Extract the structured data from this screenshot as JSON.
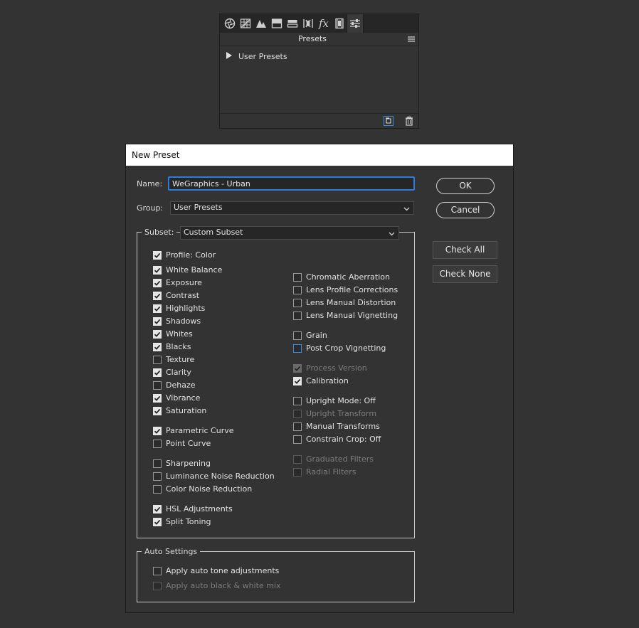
{
  "panel": {
    "title": "Presets",
    "tabs": [
      "basic-aperture-icon",
      "tone-curve-grid-icon",
      "hsl-mountains-icon",
      "split-toning-icon",
      "detail-icon",
      "lens-icon",
      "fx-icon",
      "film-camera-icon",
      "presets-sliders-icon"
    ],
    "fx_label": "fx",
    "tree_item": "User Presets"
  },
  "dialog": {
    "title": "New Preset",
    "name_label": "Name:",
    "name_value": "WeGraphics - Urban",
    "group_label": "Group:",
    "group_value": "User Presets",
    "subset_label": "Subset:",
    "subset_value": "Custom Subset",
    "ok_label": "OK",
    "cancel_label": "Cancel",
    "check_all_label": "Check All",
    "check_none_label": "Check None",
    "auto_settings_label": "Auto Settings",
    "left_items": [
      {
        "label": "Profile: Color",
        "checked": true,
        "disabled": false
      },
      {
        "label": "White Balance",
        "checked": true,
        "disabled": false
      },
      {
        "label": "Exposure",
        "checked": true,
        "disabled": false
      },
      {
        "label": "Contrast",
        "checked": true,
        "disabled": false
      },
      {
        "label": "Highlights",
        "checked": true,
        "disabled": false
      },
      {
        "label": "Shadows",
        "checked": true,
        "disabled": false
      },
      {
        "label": "Whites",
        "checked": true,
        "disabled": false
      },
      {
        "label": "Blacks",
        "checked": true,
        "disabled": false
      },
      {
        "label": "Texture",
        "checked": false,
        "disabled": false
      },
      {
        "label": "Clarity",
        "checked": true,
        "disabled": false
      },
      {
        "label": "Dehaze",
        "checked": false,
        "disabled": false
      },
      {
        "label": "Vibrance",
        "checked": true,
        "disabled": false
      },
      {
        "label": "Saturation",
        "checked": true,
        "disabled": false
      },
      {
        "label": "Parametric Curve",
        "checked": true,
        "disabled": false
      },
      {
        "label": "Point Curve",
        "checked": false,
        "disabled": false
      },
      {
        "label": "Sharpening",
        "checked": false,
        "disabled": false
      },
      {
        "label": "Luminance Noise Reduction",
        "checked": false,
        "disabled": false
      },
      {
        "label": "Color Noise Reduction",
        "checked": false,
        "disabled": false
      },
      {
        "label": "HSL Adjustments",
        "checked": true,
        "disabled": false
      },
      {
        "label": "Split Toning",
        "checked": true,
        "disabled": false
      }
    ],
    "right_items": [
      {
        "label": "Chromatic Aberration",
        "checked": false,
        "disabled": false
      },
      {
        "label": "Lens Profile Corrections",
        "checked": false,
        "disabled": false
      },
      {
        "label": "Lens Manual Distortion",
        "checked": false,
        "disabled": false
      },
      {
        "label": "Lens Manual Vignetting",
        "checked": false,
        "disabled": false
      },
      {
        "label": "Grain",
        "checked": false,
        "disabled": false
      },
      {
        "label": "Post Crop Vignetting",
        "checked": false,
        "disabled": false
      },
      {
        "label": "Process Version",
        "checked": true,
        "disabled": true
      },
      {
        "label": "Calibration",
        "checked": true,
        "disabled": false
      },
      {
        "label": "Upright Mode: Off",
        "checked": false,
        "disabled": false
      },
      {
        "label": "Upright Transform",
        "checked": false,
        "disabled": true
      },
      {
        "label": "Manual Transforms",
        "checked": false,
        "disabled": false
      },
      {
        "label": "Constrain Crop: Off",
        "checked": false,
        "disabled": false
      },
      {
        "label": "Graduated Filters",
        "checked": false,
        "disabled": true
      },
      {
        "label": "Radial Filters",
        "checked": false,
        "disabled": true
      }
    ],
    "auto_items": [
      {
        "label": "Apply auto tone adjustments",
        "checked": false,
        "disabled": false
      },
      {
        "label": "Apply auto black & white mix",
        "checked": false,
        "disabled": true
      }
    ]
  }
}
